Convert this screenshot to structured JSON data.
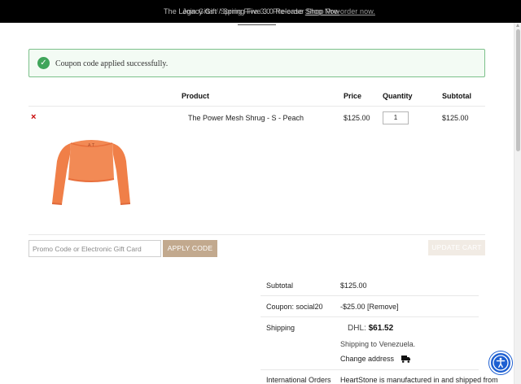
{
  "announcement": {
    "message_a": "The Legacy Gift / Spring Five 3.0 Release",
    "message_b": "Join Gifts / Spring Five 3.0 Pre-order",
    "link_a": "Shop Now",
    "link_b": "Shop Pre-order now."
  },
  "notice": {
    "text": "Coupon code applied successfully.",
    "icon": "check-icon",
    "color": "#3fa55a"
  },
  "cart": {
    "headers": {
      "product": "Product",
      "price": "Price",
      "quantity": "Quantity",
      "subtotal": "Subtotal"
    },
    "items": [
      {
        "remove": "×",
        "name": "The Power Mesh Shrug - S - Peach",
        "price": "$125.00",
        "quantity": "1",
        "subtotal": "$125.00",
        "image": "peach-mesh-shrug"
      }
    ],
    "promo_placeholder": "Promo Code or Electronic Gift Card",
    "apply_label": "APPLY CODE",
    "update_label": "UPDATE CART"
  },
  "totals": {
    "subtotal_label": "Subtotal",
    "subtotal_value": "$125.00",
    "coupon_label": "Coupon: social20",
    "coupon_value": "-$25.00",
    "coupon_remove": "[Remove]",
    "shipping_label": "Shipping",
    "shipping_carrier": "DHL:",
    "shipping_amount": "$61.52",
    "shipping_to_prefix": "Shipping to",
    "shipping_to_country": "Venezuela",
    "change_address": "Change address",
    "intl_label": "International Orders",
    "intl_value": "HeartStone is manufactured in and shipped from"
  },
  "colors": {
    "accent": "#c2a98e",
    "success": "#3fa55a",
    "remove": "#c80000",
    "accessibility": "#1d5fd1"
  }
}
